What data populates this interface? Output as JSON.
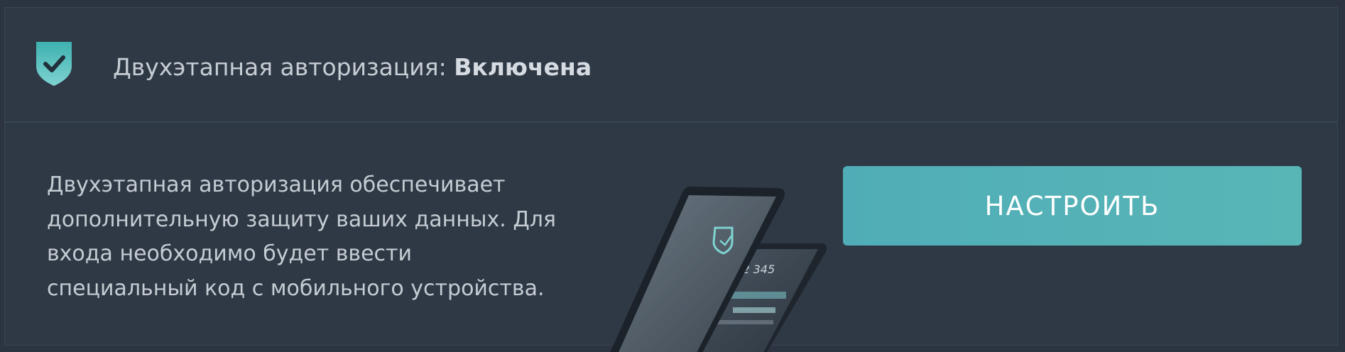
{
  "header": {
    "title_prefix": "Двухэтапная авторизация: ",
    "status": "Включена"
  },
  "description": {
    "lines": [
      "Двухэтапная авторизация обеспечивает",
      "дополнительную защиту ваших данных. Для",
      "входа необходимо будет ввести",
      "специальный код с мобильного устройства."
    ]
  },
  "setup_button": {
    "label": "НАСТРОИТЬ"
  },
  "illustration": {
    "code": "012 345"
  },
  "colors": {
    "accent": "#56b2b8",
    "background": "#2f3946",
    "shield": "#5fc0c0"
  },
  "icons": {
    "shield": "shield-check-icon"
  }
}
